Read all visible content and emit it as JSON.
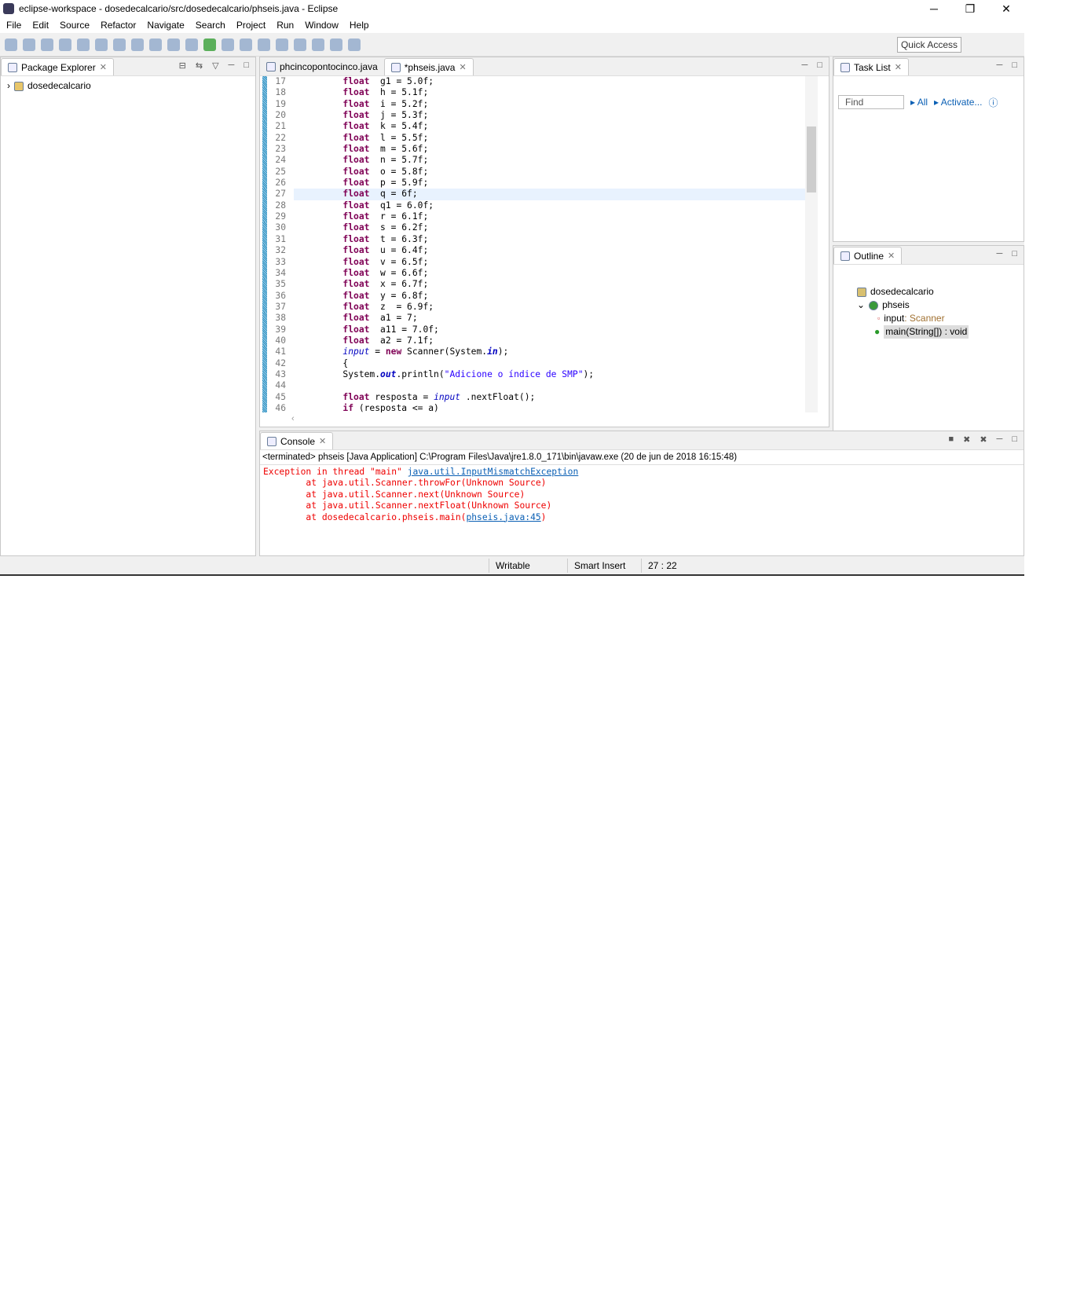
{
  "window": {
    "title": "eclipse-workspace - dosedecalcario/src/dosedecalcario/phseis.java - Eclipse"
  },
  "menu": [
    "File",
    "Edit",
    "Source",
    "Refactor",
    "Navigate",
    "Search",
    "Project",
    "Run",
    "Window",
    "Help"
  ],
  "toolbar": {
    "quick_access": "Quick Access"
  },
  "package_explorer": {
    "title": "Package Explorer",
    "items": [
      "dosedecalcario"
    ]
  },
  "editor": {
    "tabs": [
      "phcincopontocinco.java",
      "*phseis.java"
    ],
    "current_line": 27,
    "lines": [
      {
        "n": "17",
        "t": [
          [
            "kw",
            "float"
          ],
          [
            "",
            "  g1 = 5.0f;"
          ]
        ]
      },
      {
        "n": "18",
        "t": [
          [
            "kw",
            "float"
          ],
          [
            "",
            "  h = 5.1f;"
          ]
        ]
      },
      {
        "n": "19",
        "t": [
          [
            "kw",
            "float"
          ],
          [
            "",
            "  i = 5.2f;"
          ]
        ]
      },
      {
        "n": "20",
        "t": [
          [
            "kw",
            "float"
          ],
          [
            "",
            "  j = 5.3f;"
          ]
        ]
      },
      {
        "n": "21",
        "t": [
          [
            "kw",
            "float"
          ],
          [
            "",
            "  k = 5.4f;"
          ]
        ]
      },
      {
        "n": "22",
        "t": [
          [
            "kw",
            "float"
          ],
          [
            "",
            "  l = 5.5f;"
          ]
        ]
      },
      {
        "n": "23",
        "t": [
          [
            "kw",
            "float"
          ],
          [
            "",
            "  m = 5.6f;"
          ]
        ]
      },
      {
        "n": "24",
        "t": [
          [
            "kw",
            "float"
          ],
          [
            "",
            "  n = 5.7f;"
          ]
        ]
      },
      {
        "n": "25",
        "t": [
          [
            "kw",
            "float"
          ],
          [
            "",
            "  o = 5.8f;"
          ]
        ]
      },
      {
        "n": "26",
        "t": [
          [
            "kw",
            "float"
          ],
          [
            "",
            "  p = 5.9f;"
          ]
        ]
      },
      {
        "n": "27",
        "t": [
          [
            "kw",
            "float"
          ],
          [
            "",
            "  q = 6f;"
          ]
        ]
      },
      {
        "n": "28",
        "t": [
          [
            "kw",
            "float"
          ],
          [
            "",
            "  q1 = 6.0f;"
          ]
        ]
      },
      {
        "n": "29",
        "t": [
          [
            "kw",
            "float"
          ],
          [
            "",
            "  r = 6.1f;"
          ]
        ]
      },
      {
        "n": "30",
        "t": [
          [
            "kw",
            "float"
          ],
          [
            "",
            "  s = 6.2f;"
          ]
        ]
      },
      {
        "n": "31",
        "t": [
          [
            "kw",
            "float"
          ],
          [
            "",
            "  t = 6.3f;"
          ]
        ]
      },
      {
        "n": "32",
        "t": [
          [
            "kw",
            "float"
          ],
          [
            "",
            "  u = 6.4f;"
          ]
        ]
      },
      {
        "n": "33",
        "t": [
          [
            "kw",
            "float"
          ],
          [
            "",
            "  v = 6.5f;"
          ]
        ]
      },
      {
        "n": "34",
        "t": [
          [
            "kw",
            "float"
          ],
          [
            "",
            "  w = 6.6f;"
          ]
        ]
      },
      {
        "n": "35",
        "t": [
          [
            "kw",
            "float"
          ],
          [
            "",
            "  x = 6.7f;"
          ]
        ]
      },
      {
        "n": "36",
        "t": [
          [
            "kw",
            "float"
          ],
          [
            "",
            "  y = 6.8f;"
          ]
        ]
      },
      {
        "n": "37",
        "t": [
          [
            "kw",
            "float"
          ],
          [
            "",
            "  z  = 6.9f;"
          ]
        ]
      },
      {
        "n": "38",
        "t": [
          [
            "kw",
            "float"
          ],
          [
            "",
            "  a1 = 7;"
          ]
        ]
      },
      {
        "n": "39",
        "t": [
          [
            "kw",
            "float"
          ],
          [
            "",
            "  a11 = 7.0f;"
          ]
        ]
      },
      {
        "n": "40",
        "t": [
          [
            "kw",
            "float"
          ],
          [
            "",
            "  a2 = 7.1f;"
          ]
        ]
      },
      {
        "n": "41",
        "t": [
          [
            "fld",
            "input"
          ],
          [
            "",
            " = "
          ],
          [
            "kw",
            "new"
          ],
          [
            "",
            " Scanner(System."
          ],
          [
            "fldb",
            "in"
          ],
          [
            "",
            ");"
          ]
        ]
      },
      {
        "n": "42",
        "t": [
          [
            "",
            "{"
          ]
        ]
      },
      {
        "n": "43",
        "t": [
          [
            "",
            "System."
          ],
          [
            "fldb",
            "out"
          ],
          [
            "",
            ".println("
          ],
          [
            "str",
            "\"Adicione o índice de SMP\""
          ],
          [
            "",
            ");"
          ]
        ]
      },
      {
        "n": "44",
        "t": []
      },
      {
        "n": "45",
        "t": [
          [
            "kw",
            "float"
          ],
          [
            "",
            " resposta = "
          ],
          [
            "fld",
            "input"
          ],
          [
            "",
            " .nextFloat();"
          ]
        ]
      },
      {
        "n": "46",
        "t": [
          [
            "kw",
            "if"
          ],
          [
            "",
            " (resposta <= a)"
          ]
        ]
      }
    ]
  },
  "task_list": {
    "title": "Task List",
    "find_placeholder": "Find",
    "all": "All",
    "activate": "Activate..."
  },
  "outline": {
    "title": "Outline",
    "items": [
      {
        "label": "dosedecalcario"
      },
      {
        "label": "phseis"
      },
      {
        "label": "input",
        "type": " : Scanner"
      },
      {
        "label": "main(String[]) : void"
      }
    ]
  },
  "console": {
    "title": "Console",
    "header": "<terminated> phseis [Java Application] C:\\Program Files\\Java\\jre1.8.0_171\\bin\\javaw.exe (20 de jun de 2018 16:15:48)",
    "exception_prefix": "Exception in thread \"main\" ",
    "exception_link": "java.util.InputMismatchException",
    "stack": [
      "        at java.util.Scanner.throwFor(Unknown Source)",
      "        at java.util.Scanner.next(Unknown Source)",
      "        at java.util.Scanner.nextFloat(Unknown Source)"
    ],
    "last_prefix": "        at dosedecalcario.phseis.main(",
    "last_link": "phseis.java:45",
    "last_suffix": ")"
  },
  "status": {
    "mode": "Writable",
    "insert": "Smart Insert",
    "position": "27 : 22"
  }
}
